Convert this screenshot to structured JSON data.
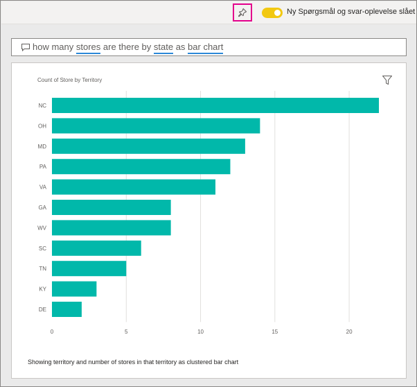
{
  "toolbar": {
    "pin_label": "",
    "toggle_on": true,
    "toggle_label": "Ny Spørgsmål og svar-oplevelse slået til",
    "accent_color": "#f2c811",
    "highlight_color": "#e3008c"
  },
  "qa": {
    "icon": "chat-bubble-icon",
    "segments": [
      {
        "text": "how many ",
        "keyword": false
      },
      {
        "text": "stores",
        "keyword": true
      },
      {
        "text": " are there by ",
        "keyword": false
      },
      {
        "text": "state",
        "keyword": true
      },
      {
        "text": " as ",
        "keyword": false
      },
      {
        "text": "bar chart",
        "keyword": true
      }
    ]
  },
  "visual": {
    "filter_icon": "filter-icon",
    "footer": "Showing territory and number of stores in that territory as clustered bar chart"
  },
  "chart_data": {
    "type": "bar",
    "orientation": "horizontal",
    "title": "Count of Store by Territory",
    "xlabel": "",
    "ylabel": "",
    "categories": [
      "NC",
      "OH",
      "MD",
      "PA",
      "VA",
      "GA",
      "WV",
      "SC",
      "TN",
      "KY",
      "DE"
    ],
    "values": [
      22,
      14,
      13,
      12,
      11,
      8,
      8,
      6,
      5,
      3,
      2
    ],
    "xlim": [
      0,
      22
    ],
    "xticks": [
      0,
      5,
      10,
      15,
      20
    ],
    "grid": true,
    "bar_color": "#01b8aa"
  }
}
